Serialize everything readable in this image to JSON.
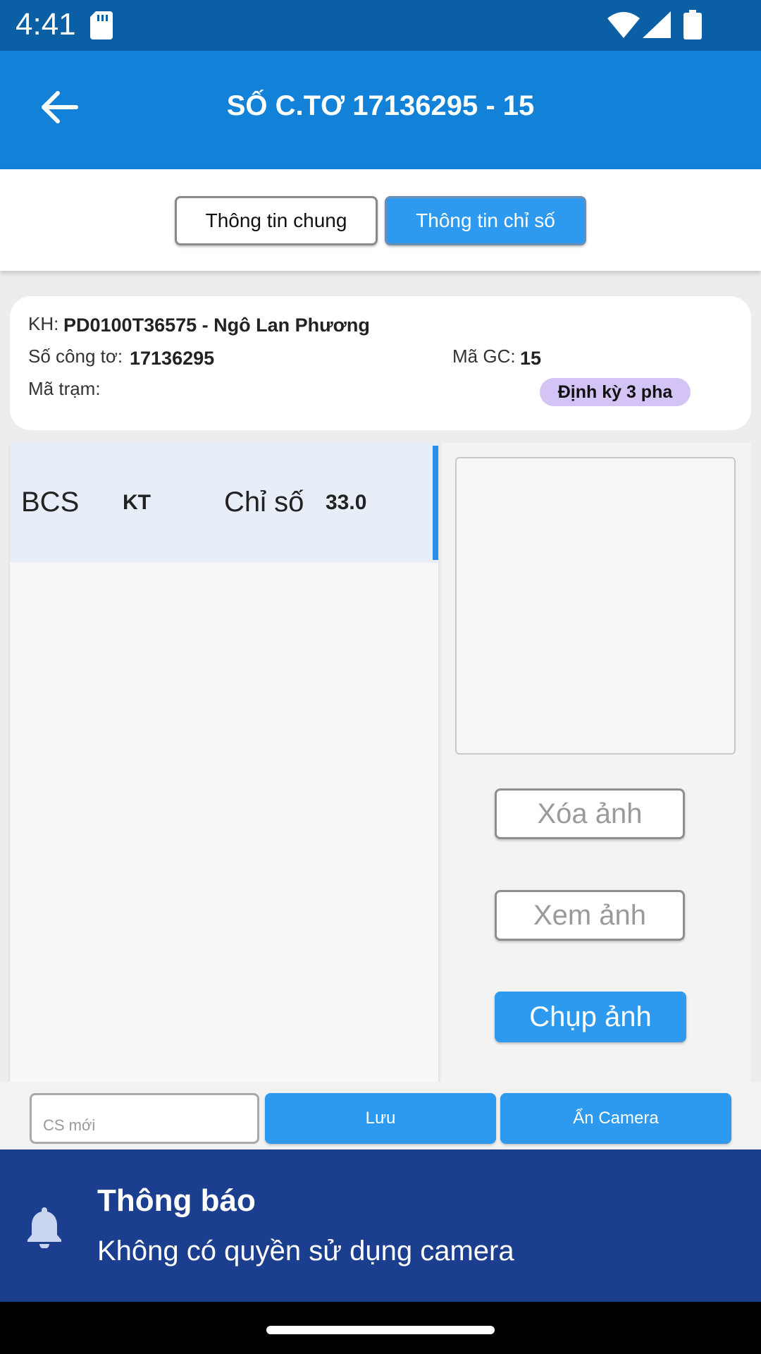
{
  "status_bar": {
    "time": "4:41"
  },
  "app_bar": {
    "title": "SỐ C.TƠ 17136295 - 15"
  },
  "tabs": [
    {
      "label": "Thông tin chung",
      "active": false
    },
    {
      "label": "Thông tin chỉ số",
      "active": true
    }
  ],
  "customer": {
    "kh_label": "KH:",
    "kh_value": "PD0100T36575 - Ngô Lan Phương",
    "meter_label": "Số công tơ:",
    "meter_value": "17136295",
    "gc_label": "Mã GC:",
    "gc_value": "15",
    "station_label": "Mã trạm:",
    "station_value": "",
    "badge": "Định kỳ 3 pha"
  },
  "readings": [
    {
      "bcs": "BCS",
      "type": "KT",
      "label": "Chỉ số",
      "value": "33.0"
    }
  ],
  "camera": {
    "delete_label": "Xóa ảnh",
    "view_label": "Xem ảnh",
    "capture_label": "Chụp ảnh"
  },
  "input_row": {
    "new_index_placeholder": "CS mới",
    "new_index_value": "",
    "save_label": "Lưu",
    "hide_camera_label": "Ẩn Camera"
  },
  "notification": {
    "title": "Thông báo",
    "message": "Không có quyền sử dụng camera"
  },
  "colors": {
    "status_bar": "#0b5fa5",
    "app_bar": "#1282d8",
    "accent": "#2d9af0",
    "notification": "#1b3f8e",
    "badge": "#d3c4f5"
  },
  "icons": [
    "sd-card-icon",
    "wifi-icon",
    "signal-icon",
    "battery-icon",
    "back-arrow-icon",
    "bell-icon"
  ]
}
